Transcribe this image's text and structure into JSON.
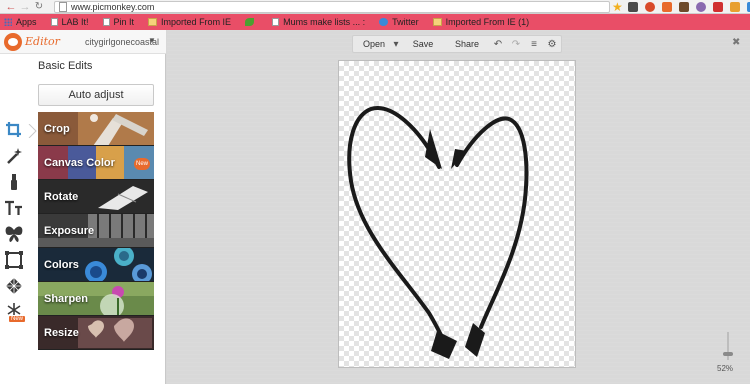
{
  "browser": {
    "url": "www.picmonkey.com",
    "bookmarks": [
      {
        "label": "Apps",
        "icon": "apps-grid-icon"
      },
      {
        "label": "LAB It!",
        "icon": "page-icon"
      },
      {
        "label": "Pin It",
        "icon": "page-icon"
      },
      {
        "label": "Imported From IE",
        "icon": "folder-icon"
      },
      {
        "label": "",
        "icon": "green-leaf-icon"
      },
      {
        "label": "Mums make lists ... :",
        "icon": "page-icon"
      },
      {
        "label": "Twitter",
        "icon": "twitter-icon"
      },
      {
        "label": "Imported From IE (1)",
        "icon": "folder-icon"
      }
    ]
  },
  "brand": {
    "logo": "Editor"
  },
  "user": {
    "name": "citygirlgonecoastal"
  },
  "panel": {
    "section_title": "Basic Edits",
    "auto_adjust": "Auto adjust",
    "items": [
      {
        "label": "Crop"
      },
      {
        "label": "Canvas Color",
        "badge": "New"
      },
      {
        "label": "Rotate"
      },
      {
        "label": "Exposure"
      },
      {
        "label": "Colors"
      },
      {
        "label": "Sharpen"
      },
      {
        "label": "Resize"
      }
    ]
  },
  "rail": {
    "tools": [
      "crop-icon",
      "magic-wand-icon",
      "brush-icon",
      "text-icon",
      "butterfly-icon",
      "frame-icon",
      "texture-icon",
      "snowflake-icon"
    ],
    "new_tag": "New"
  },
  "toolbar": {
    "open": "Open",
    "save": "Save",
    "share": "Share"
  },
  "zoom": {
    "label": "52%"
  },
  "colors": {
    "brand": "#e86a2c",
    "bookmark_bar": "#e94e67",
    "accent": "#3b88c5"
  }
}
